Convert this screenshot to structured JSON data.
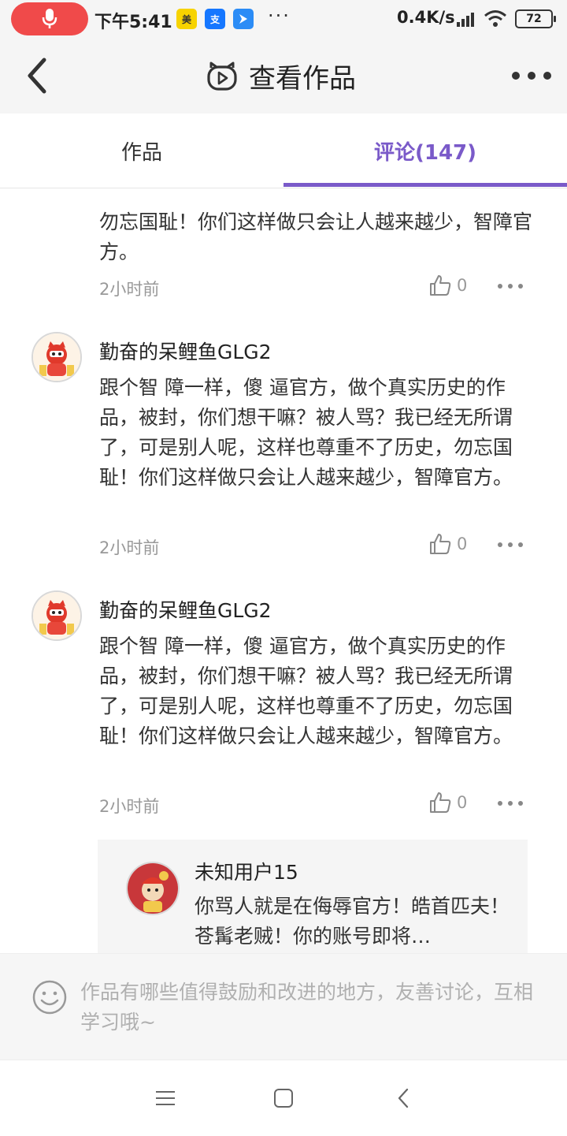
{
  "status_bar": {
    "time": "下午5:41",
    "net_speed": "0.4K/s",
    "battery": "72",
    "app_icons": [
      "meituan-icon",
      "alipay-icon",
      "blue-app-icon"
    ],
    "dots": "···"
  },
  "header": {
    "title": "查看作品"
  },
  "tabs": {
    "works": "作品",
    "comments": "评论(147)"
  },
  "comments": [
    {
      "username": "",
      "text": "勿忘国耻！你们这样做只会让人越来越少，智障官方。",
      "time": "2小时前",
      "likes": "0"
    },
    {
      "username": "勤奋的呆鲤鱼GLG2",
      "text": "跟个智 障一样，傻 逼官方，做个真实历史的作品，被封，你们想干嘛？被人骂？我已经无所谓了，可是别人呢，这样也尊重不了历史，勿忘国耻！你们这样做只会让人越来越少，智障官方。",
      "time": "2小时前",
      "likes": "0"
    },
    {
      "username": "勤奋的呆鲤鱼GLG2",
      "text": "跟个智 障一样，傻 逼官方，做个真实历史的作品，被封，你们想干嘛？被人骂？我已经无所谓了，可是别人呢，这样也尊重不了历史，勿忘国耻！你们这样做只会让人越来越少，智障官方。",
      "time": "2小时前",
      "likes": "0"
    }
  ],
  "reply": {
    "username": "未知用户15",
    "text": "你骂人就是在侮辱官方！皓首匹夫！苍髯老贼！你的账号即将…"
  },
  "input": {
    "placeholder": "作品有哪些值得鼓励和改进的地方，友善讨论，互相学习哦~"
  },
  "colors": {
    "accent": "#7a5ac9",
    "mic_pill": "#f04a4a"
  }
}
